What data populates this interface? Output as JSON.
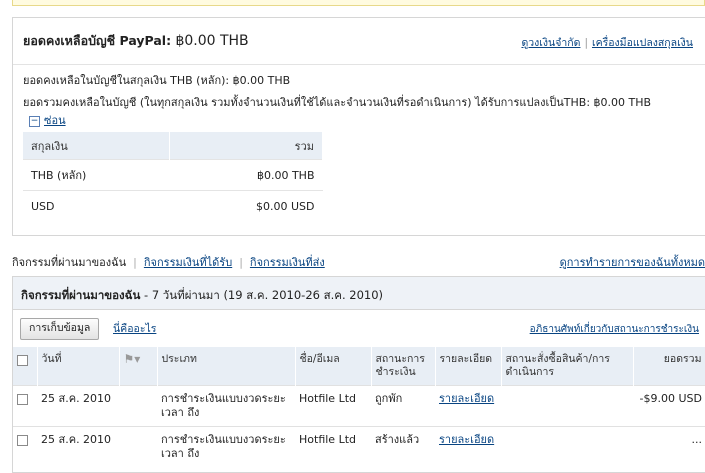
{
  "balance": {
    "title": "ยอดคงเหลือบัญชี PayPal:",
    "amount": "฿0.00 THB",
    "links": [
      "ดูวงเงินจำกัด",
      "เครื่องมือแปลงสกุลเงิน"
    ],
    "line1": "ยอดคงเหลือในบัญชีในสกุลเงิน THB (หลัก): ฿0.00 THB",
    "line2": "ยอดรวมคงเหลือในบัญชี (ในทุกสกุลเงิน รวมทั้งจำนวนเงินที่ใช้ได้และจำนวนเงินที่รอดำเนินการ) ได้รับการแปลงเป็นTHB: ฿0.00 THB",
    "hide_label": "ซ่อน",
    "hide_symbol": "−",
    "table": {
      "headers": [
        "สกุลเงิน",
        "รวม"
      ],
      "rows": [
        {
          "currency": "THB (หลัก)",
          "total": "฿0.00 THB"
        },
        {
          "currency": "USD",
          "total": "$0.00 USD"
        }
      ]
    }
  },
  "tabs": {
    "current": "กิจกรรมที่ผ่านมาของฉัน",
    "received": "กิจกรรมเงินที่ได้รับ",
    "sent": "กิจกรรมเงินที่ส่ง",
    "view_all": "ดูการทำรายการของฉันทั้งหมด"
  },
  "activity": {
    "title": "กิจกรรมที่ผ่านมาของฉัน",
    "subtitle": " - 7 วันที่ผ่านมา (19 ส.ค. 2010-26 ส.ค. 2010)",
    "save_button": "การเก็บข้อมูล",
    "what_is": "นี่คืออะไร",
    "glossary": "อภิธานศัพท์เกี่ยวกับสถานะการชำระเงิน",
    "headers": {
      "date": "วันที่",
      "type": "ประเภท",
      "name": "ชื่อ/อีเมล",
      "payment_status": "สถานะการชำระเงิน",
      "details": "รายละเอียด",
      "order_status": "สถานะสั่งซื้อสินค้า/การดำเนินการ",
      "gross": "ยอดรวม"
    },
    "rows": [
      {
        "date": "25 ส.ค. 2010",
        "type": "การชำระเงินแบบงวดระยะเวลา ถึง",
        "name": "Hotfile Ltd",
        "status": "ถูกพัก",
        "details": "รายละเอียด",
        "order_status": "",
        "gross": "-$9.00 USD"
      },
      {
        "date": "25 ส.ค. 2010",
        "type": "การชำระเงินแบบงวดระยะเวลา ถึง",
        "name": "Hotfile Ltd",
        "status": "สร้างแล้ว",
        "details": "รายละเอียด",
        "order_status": "",
        "gross": "..."
      }
    ]
  },
  "icons": {
    "flag": "flag-icon",
    "checkbox": "checkbox",
    "collapse": "minus-box-icon"
  }
}
